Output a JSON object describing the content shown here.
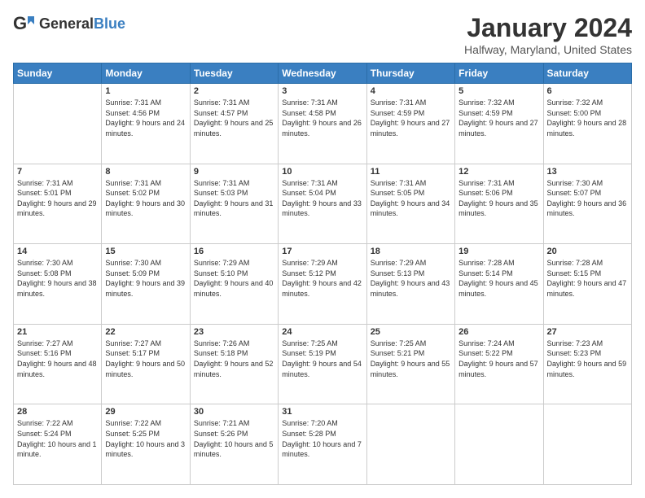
{
  "header": {
    "logo_line1": "General",
    "logo_line2": "Blue",
    "month": "January 2024",
    "location": "Halfway, Maryland, United States"
  },
  "weekdays": [
    "Sunday",
    "Monday",
    "Tuesday",
    "Wednesday",
    "Thursday",
    "Friday",
    "Saturday"
  ],
  "weeks": [
    [
      {
        "day": "",
        "sunrise": "",
        "sunset": "",
        "daylight": ""
      },
      {
        "day": "1",
        "sunrise": "Sunrise: 7:31 AM",
        "sunset": "Sunset: 4:56 PM",
        "daylight": "Daylight: 9 hours and 24 minutes."
      },
      {
        "day": "2",
        "sunrise": "Sunrise: 7:31 AM",
        "sunset": "Sunset: 4:57 PM",
        "daylight": "Daylight: 9 hours and 25 minutes."
      },
      {
        "day": "3",
        "sunrise": "Sunrise: 7:31 AM",
        "sunset": "Sunset: 4:58 PM",
        "daylight": "Daylight: 9 hours and 26 minutes."
      },
      {
        "day": "4",
        "sunrise": "Sunrise: 7:31 AM",
        "sunset": "Sunset: 4:59 PM",
        "daylight": "Daylight: 9 hours and 27 minutes."
      },
      {
        "day": "5",
        "sunrise": "Sunrise: 7:32 AM",
        "sunset": "Sunset: 4:59 PM",
        "daylight": "Daylight: 9 hours and 27 minutes."
      },
      {
        "day": "6",
        "sunrise": "Sunrise: 7:32 AM",
        "sunset": "Sunset: 5:00 PM",
        "daylight": "Daylight: 9 hours and 28 minutes."
      }
    ],
    [
      {
        "day": "7",
        "sunrise": "Sunrise: 7:31 AM",
        "sunset": "Sunset: 5:01 PM",
        "daylight": "Daylight: 9 hours and 29 minutes."
      },
      {
        "day": "8",
        "sunrise": "Sunrise: 7:31 AM",
        "sunset": "Sunset: 5:02 PM",
        "daylight": "Daylight: 9 hours and 30 minutes."
      },
      {
        "day": "9",
        "sunrise": "Sunrise: 7:31 AM",
        "sunset": "Sunset: 5:03 PM",
        "daylight": "Daylight: 9 hours and 31 minutes."
      },
      {
        "day": "10",
        "sunrise": "Sunrise: 7:31 AM",
        "sunset": "Sunset: 5:04 PM",
        "daylight": "Daylight: 9 hours and 33 minutes."
      },
      {
        "day": "11",
        "sunrise": "Sunrise: 7:31 AM",
        "sunset": "Sunset: 5:05 PM",
        "daylight": "Daylight: 9 hours and 34 minutes."
      },
      {
        "day": "12",
        "sunrise": "Sunrise: 7:31 AM",
        "sunset": "Sunset: 5:06 PM",
        "daylight": "Daylight: 9 hours and 35 minutes."
      },
      {
        "day": "13",
        "sunrise": "Sunrise: 7:30 AM",
        "sunset": "Sunset: 5:07 PM",
        "daylight": "Daylight: 9 hours and 36 minutes."
      }
    ],
    [
      {
        "day": "14",
        "sunrise": "Sunrise: 7:30 AM",
        "sunset": "Sunset: 5:08 PM",
        "daylight": "Daylight: 9 hours and 38 minutes."
      },
      {
        "day": "15",
        "sunrise": "Sunrise: 7:30 AM",
        "sunset": "Sunset: 5:09 PM",
        "daylight": "Daylight: 9 hours and 39 minutes."
      },
      {
        "day": "16",
        "sunrise": "Sunrise: 7:29 AM",
        "sunset": "Sunset: 5:10 PM",
        "daylight": "Daylight: 9 hours and 40 minutes."
      },
      {
        "day": "17",
        "sunrise": "Sunrise: 7:29 AM",
        "sunset": "Sunset: 5:12 PM",
        "daylight": "Daylight: 9 hours and 42 minutes."
      },
      {
        "day": "18",
        "sunrise": "Sunrise: 7:29 AM",
        "sunset": "Sunset: 5:13 PM",
        "daylight": "Daylight: 9 hours and 43 minutes."
      },
      {
        "day": "19",
        "sunrise": "Sunrise: 7:28 AM",
        "sunset": "Sunset: 5:14 PM",
        "daylight": "Daylight: 9 hours and 45 minutes."
      },
      {
        "day": "20",
        "sunrise": "Sunrise: 7:28 AM",
        "sunset": "Sunset: 5:15 PM",
        "daylight": "Daylight: 9 hours and 47 minutes."
      }
    ],
    [
      {
        "day": "21",
        "sunrise": "Sunrise: 7:27 AM",
        "sunset": "Sunset: 5:16 PM",
        "daylight": "Daylight: 9 hours and 48 minutes."
      },
      {
        "day": "22",
        "sunrise": "Sunrise: 7:27 AM",
        "sunset": "Sunset: 5:17 PM",
        "daylight": "Daylight: 9 hours and 50 minutes."
      },
      {
        "day": "23",
        "sunrise": "Sunrise: 7:26 AM",
        "sunset": "Sunset: 5:18 PM",
        "daylight": "Daylight: 9 hours and 52 minutes."
      },
      {
        "day": "24",
        "sunrise": "Sunrise: 7:25 AM",
        "sunset": "Sunset: 5:19 PM",
        "daylight": "Daylight: 9 hours and 54 minutes."
      },
      {
        "day": "25",
        "sunrise": "Sunrise: 7:25 AM",
        "sunset": "Sunset: 5:21 PM",
        "daylight": "Daylight: 9 hours and 55 minutes."
      },
      {
        "day": "26",
        "sunrise": "Sunrise: 7:24 AM",
        "sunset": "Sunset: 5:22 PM",
        "daylight": "Daylight: 9 hours and 57 minutes."
      },
      {
        "day": "27",
        "sunrise": "Sunrise: 7:23 AM",
        "sunset": "Sunset: 5:23 PM",
        "daylight": "Daylight: 9 hours and 59 minutes."
      }
    ],
    [
      {
        "day": "28",
        "sunrise": "Sunrise: 7:22 AM",
        "sunset": "Sunset: 5:24 PM",
        "daylight": "Daylight: 10 hours and 1 minute."
      },
      {
        "day": "29",
        "sunrise": "Sunrise: 7:22 AM",
        "sunset": "Sunset: 5:25 PM",
        "daylight": "Daylight: 10 hours and 3 minutes."
      },
      {
        "day": "30",
        "sunrise": "Sunrise: 7:21 AM",
        "sunset": "Sunset: 5:26 PM",
        "daylight": "Daylight: 10 hours and 5 minutes."
      },
      {
        "day": "31",
        "sunrise": "Sunrise: 7:20 AM",
        "sunset": "Sunset: 5:28 PM",
        "daylight": "Daylight: 10 hours and 7 minutes."
      },
      {
        "day": "",
        "sunrise": "",
        "sunset": "",
        "daylight": ""
      },
      {
        "day": "",
        "sunrise": "",
        "sunset": "",
        "daylight": ""
      },
      {
        "day": "",
        "sunrise": "",
        "sunset": "",
        "daylight": ""
      }
    ]
  ]
}
